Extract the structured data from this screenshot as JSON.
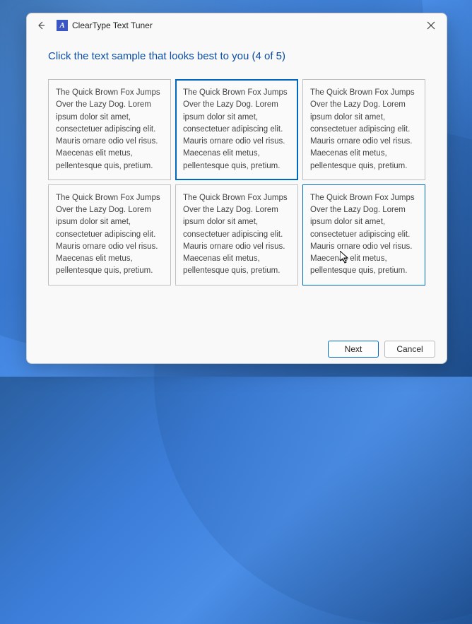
{
  "titlebar": {
    "app_icon_letter": "A",
    "title": "ClearType Text Tuner"
  },
  "instruction": "Click the text sample that looks best to you (4 of 5)",
  "sample_text": "The Quick Brown Fox Jumps Over the Lazy Dog. Lorem ipsum dolor sit amet, consectetuer adipiscing elit. Mauris ornare odio vel risus. Maecenas elit metus, pellentesque quis, pretium.",
  "samples": [
    {
      "selected": false,
      "hover": false
    },
    {
      "selected": true,
      "hover": false
    },
    {
      "selected": false,
      "hover": false
    },
    {
      "selected": false,
      "hover": false
    },
    {
      "selected": false,
      "hover": false
    },
    {
      "selected": false,
      "hover": true
    }
  ],
  "footer": {
    "next_label": "Next",
    "cancel_label": "Cancel"
  }
}
